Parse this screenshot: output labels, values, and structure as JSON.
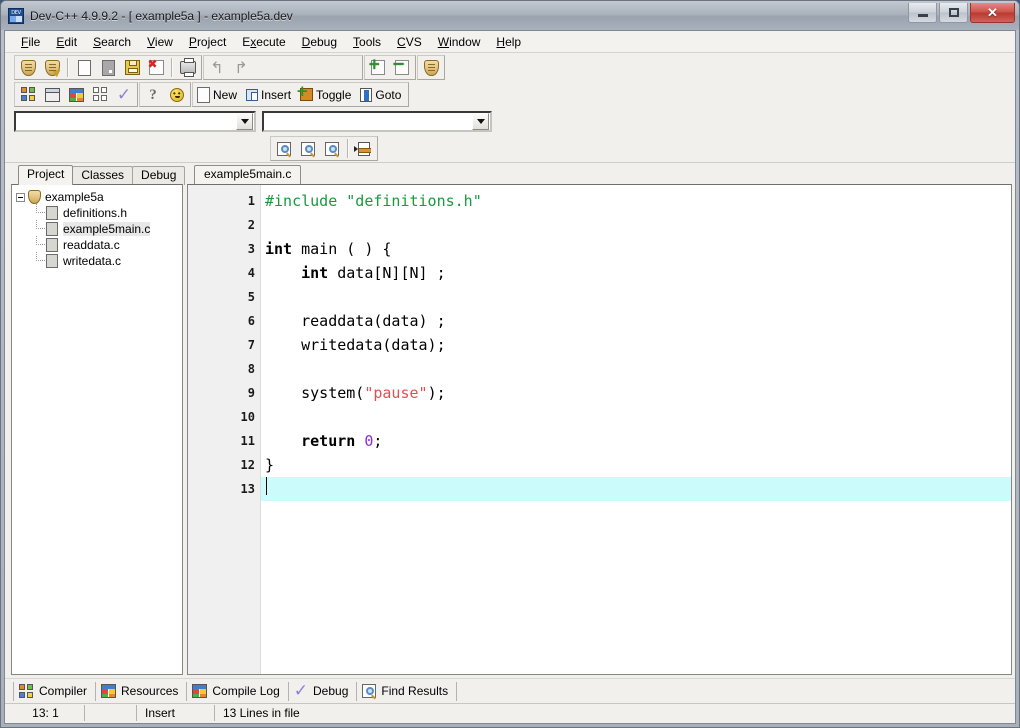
{
  "window": {
    "title": "Dev-C++ 4.9.9.2  -  [ example5a ] - example5a.dev",
    "ghost_title": "",
    "app_icon": "dev-cpp-icon",
    "minimize_label": "",
    "maximize_label": "",
    "close_label": "✕"
  },
  "menubar": {
    "items": [
      {
        "label": "File",
        "mnemonic": "F"
      },
      {
        "label": "Edit",
        "mnemonic": "E"
      },
      {
        "label": "Search",
        "mnemonic": "S"
      },
      {
        "label": "View",
        "mnemonic": "V"
      },
      {
        "label": "Project",
        "mnemonic": "P"
      },
      {
        "label": "Execute",
        "mnemonic": "x"
      },
      {
        "label": "Debug",
        "mnemonic": "D"
      },
      {
        "label": "Tools",
        "mnemonic": "T"
      },
      {
        "label": "CVS",
        "mnemonic": "C"
      },
      {
        "label": "Window",
        "mnemonic": "W"
      },
      {
        "label": "Help",
        "mnemonic": "H"
      }
    ]
  },
  "toolbar1": {
    "buttons": [
      {
        "name": "new-project-icon",
        "label": ""
      },
      {
        "name": "open-project-icon",
        "label": ""
      },
      {
        "name": "new-file-icon",
        "label": ""
      },
      {
        "name": "open-file-icon",
        "label": ""
      },
      {
        "name": "save-file-icon",
        "label": ""
      },
      {
        "name": "save-all-icon",
        "label": ""
      },
      {
        "name": "print-icon",
        "label": ""
      },
      {
        "name": "undo-icon",
        "label": "↰"
      },
      {
        "name": "redo-icon",
        "label": "↱"
      },
      {
        "name": "add-to-project-icon",
        "label": ""
      },
      {
        "name": "remove-from-project-icon",
        "label": ""
      },
      {
        "name": "project-options-icon",
        "label": ""
      }
    ]
  },
  "toolbar2": {
    "buttons": [
      {
        "name": "compile-icon",
        "label": ""
      },
      {
        "name": "run-icon",
        "label": ""
      },
      {
        "name": "compile-and-run-icon",
        "label": ""
      },
      {
        "name": "rebuild-all-icon",
        "label": ""
      },
      {
        "name": "syntax-check-icon",
        "label": ""
      },
      {
        "name": "help-icon",
        "label": ""
      },
      {
        "name": "about-icon",
        "label": ""
      }
    ],
    "labeled": [
      {
        "name": "new-bookmark-button",
        "label": "New"
      },
      {
        "name": "insert-button",
        "label": "Insert"
      },
      {
        "name": "toggle-bookmark-button",
        "label": "Toggle"
      },
      {
        "name": "goto-button",
        "label": "Goto"
      }
    ]
  },
  "combos": {
    "left_value": "",
    "left_placeholder": "",
    "right_value": "",
    "right_placeholder": ""
  },
  "search_toolbar": {
    "buttons": [
      {
        "name": "find-icon",
        "label": ""
      },
      {
        "name": "find-next-icon",
        "label": ""
      },
      {
        "name": "replace-icon",
        "label": ""
      },
      {
        "name": "goto-line-icon",
        "label": ""
      }
    ]
  },
  "left_panel": {
    "tabs": [
      {
        "label": "Project",
        "active": true
      },
      {
        "label": "Classes",
        "active": false
      },
      {
        "label": "Debug",
        "active": false
      }
    ],
    "tree": {
      "root": "example5a",
      "files": [
        {
          "label": "definitions.h",
          "selected": false
        },
        {
          "label": "example5main.c",
          "selected": true
        },
        {
          "label": "readdata.c",
          "selected": false
        },
        {
          "label": "writedata.c",
          "selected": false
        }
      ]
    }
  },
  "editor": {
    "tabs": [
      {
        "label": "example5main.c",
        "active": true
      }
    ],
    "lines": [
      {
        "n": "1",
        "text": "#include \"definitions.h\"",
        "current": false
      },
      {
        "n": "2",
        "text": "",
        "current": false
      },
      {
        "n": "3",
        "text": "int main ( ) {",
        "current": false
      },
      {
        "n": "4",
        "text": "    int data[N][N] ;",
        "current": false
      },
      {
        "n": "5",
        "text": "",
        "current": false
      },
      {
        "n": "6",
        "text": "    readdata(data) ;",
        "current": false
      },
      {
        "n": "7",
        "text": "    writedata(data);",
        "current": false
      },
      {
        "n": "8",
        "text": "",
        "current": false
      },
      {
        "n": "9",
        "text": "    system(\"pause\");",
        "current": false
      },
      {
        "n": "10",
        "text": "",
        "current": false
      },
      {
        "n": "11",
        "text": "    return 0;",
        "current": false
      },
      {
        "n": "12",
        "text": "}",
        "current": false
      },
      {
        "n": "13",
        "text": "",
        "current": true
      }
    ],
    "colors": {
      "preprocessor": "#1a9a3c",
      "string": "#e05050",
      "keyword": "#000000",
      "number": "#8a2be2",
      "current_line_bg": "#ccfbfb"
    }
  },
  "bottom_tabs": [
    {
      "label": "Compiler",
      "icon": "compiler-icon"
    },
    {
      "label": "Resources",
      "icon": "resources-icon"
    },
    {
      "label": "Compile Log",
      "icon": "compile-log-icon"
    },
    {
      "label": "Debug",
      "icon": "debug-icon"
    },
    {
      "label": "Find Results",
      "icon": "find-results-icon"
    }
  ],
  "statusbar": {
    "cursor": "13: 1",
    "modified": "",
    "mode": "Insert",
    "lines": "13 Lines in file"
  }
}
